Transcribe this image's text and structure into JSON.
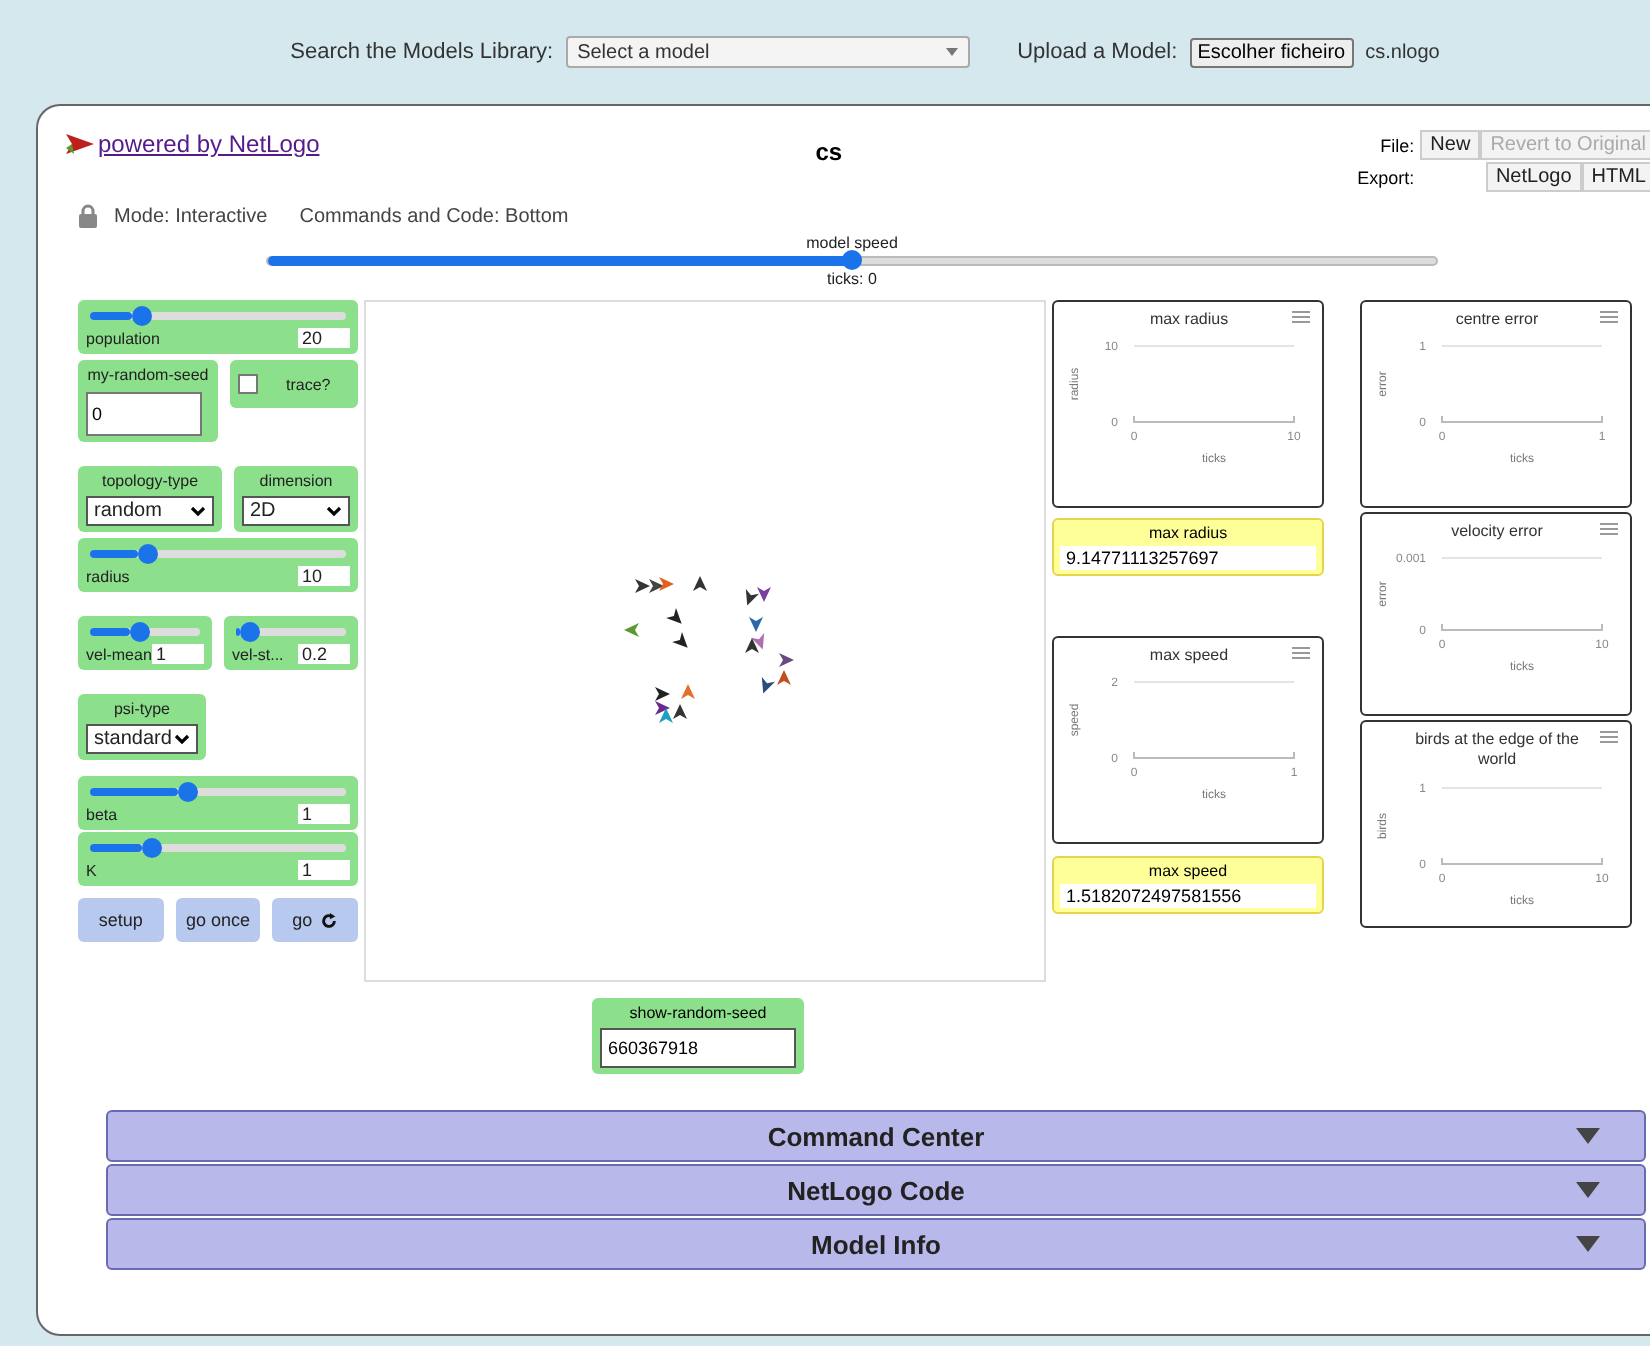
{
  "top_bar": {
    "search_label": "Search the Models Library:",
    "model_select": "Select a model",
    "upload_label": "Upload a Model:",
    "upload_button": "Escolher ficheiro",
    "file_name": "cs.nlogo"
  },
  "header": {
    "link": "powered by NetLogo",
    "title": "cs",
    "mode": "Mode: Interactive",
    "layout": "Commands and Code: Bottom",
    "file_label": "File:",
    "file_buttons": [
      {
        "label": "New",
        "disabled": false
      },
      {
        "label": "Revert to Original",
        "disabled": true
      }
    ],
    "export_label": "Export:",
    "export_buttons": [
      {
        "label": "NetLogo",
        "disabled": false
      },
      {
        "label": "HTML",
        "disabled": false
      }
    ]
  },
  "speed": {
    "label": "model speed",
    "level": 0.5,
    "ticks": "ticks: 0"
  },
  "left_rows": [
    {
      "widgets": [
        {
          "kind": "slider",
          "label": "population",
          "value": "20",
          "level": 0.2
        }
      ]
    },
    {
      "widgets": [
        {
          "kind": "input",
          "label": "my-random-seed",
          "value": "0"
        },
        {
          "kind": "switch",
          "label": "trace?",
          "on": false
        }
      ]
    },
    {
      "widgets": [
        {
          "kind": "chooser",
          "label": "topology-type",
          "value": "random"
        },
        {
          "kind": "chooser",
          "label": "dimension",
          "value": "2D"
        }
      ]
    },
    {
      "widgets": [
        {
          "kind": "slider",
          "label": "radius",
          "value": "10",
          "level": 0.23
        }
      ]
    },
    {
      "widgets": [
        {
          "kind": "slider",
          "label": "vel-mean",
          "value": "1",
          "level": 0.45
        },
        {
          "kind": "slider",
          "label": "vel-st...",
          "value": "0.2",
          "level": 0.12
        }
      ]
    },
    {
      "widgets": [
        {
          "kind": "chooser",
          "label": "psi-type",
          "value": "standard"
        }
      ]
    },
    {
      "widgets": [
        {
          "kind": "slider",
          "label": "beta",
          "value": "1",
          "level": 0.38
        }
      ]
    },
    {
      "widgets": [
        {
          "kind": "slider",
          "label": "K",
          "value": "1",
          "level": 0.24
        }
      ]
    },
    {
      "widgets": [
        {
          "kind": "button",
          "label": "setup",
          "forever": false
        },
        {
          "kind": "button",
          "label": "go once",
          "forever": false
        },
        {
          "kind": "button",
          "label": "go",
          "forever": true
        }
      ]
    }
  ],
  "view_monitor": {
    "label": "show-random-seed",
    "value": "660367918"
  },
  "middle_column": [
    {
      "kind": "plot",
      "chart_data": {
        "type": "line",
        "title": "max radius",
        "xlabel": "ticks",
        "ylabel": "radius",
        "xlim": [
          0,
          10
        ],
        "ylim": [
          0,
          10
        ],
        "xticks": [
          0,
          10
        ],
        "yticks": [
          0,
          10
        ]
      }
    },
    {
      "kind": "monitor",
      "label": "max radius",
      "value": "9.14771113257697"
    },
    {
      "kind": "plot",
      "chart_data": {
        "type": "line",
        "title": "max speed",
        "xlabel": "ticks",
        "ylabel": "speed",
        "xlim": [
          0,
          1
        ],
        "ylim": [
          0,
          2
        ],
        "xticks": [
          0,
          1
        ],
        "yticks": [
          0,
          2
        ]
      }
    },
    {
      "kind": "monitor",
      "label": "max speed",
      "value": "1.5182072497581556"
    }
  ],
  "right_column": [
    {
      "kind": "plot",
      "chart_data": {
        "type": "line",
        "title": "centre error",
        "xlabel": "ticks",
        "ylabel": "error",
        "xlim": [
          0,
          1
        ],
        "ylim": [
          0,
          1
        ],
        "xticks": [
          0,
          1
        ],
        "yticks": [
          0,
          1
        ]
      }
    },
    {
      "kind": "plot",
      "chart_data": {
        "type": "line",
        "title": "velocity error",
        "xlabel": "ticks",
        "ylabel": "error",
        "xlim": [
          0,
          10
        ],
        "ylim": [
          0,
          0.001
        ],
        "xticks": [
          0,
          10
        ],
        "yticks": [
          0,
          0.001
        ]
      }
    },
    {
      "kind": "plot",
      "chart_data": {
        "type": "line",
        "title": "birds at the edge of the world",
        "xlabel": "ticks",
        "ylabel": "birds",
        "xlim": [
          0,
          10
        ],
        "ylim": [
          0,
          1
        ],
        "xticks": [
          0,
          10
        ],
        "yticks": [
          0,
          1
        ]
      }
    }
  ],
  "sections": [
    {
      "label": "Command Center",
      "expanded": false
    },
    {
      "label": "NetLogo Code",
      "expanded": false
    },
    {
      "label": "Model Info",
      "expanded": false
    }
  ]
}
